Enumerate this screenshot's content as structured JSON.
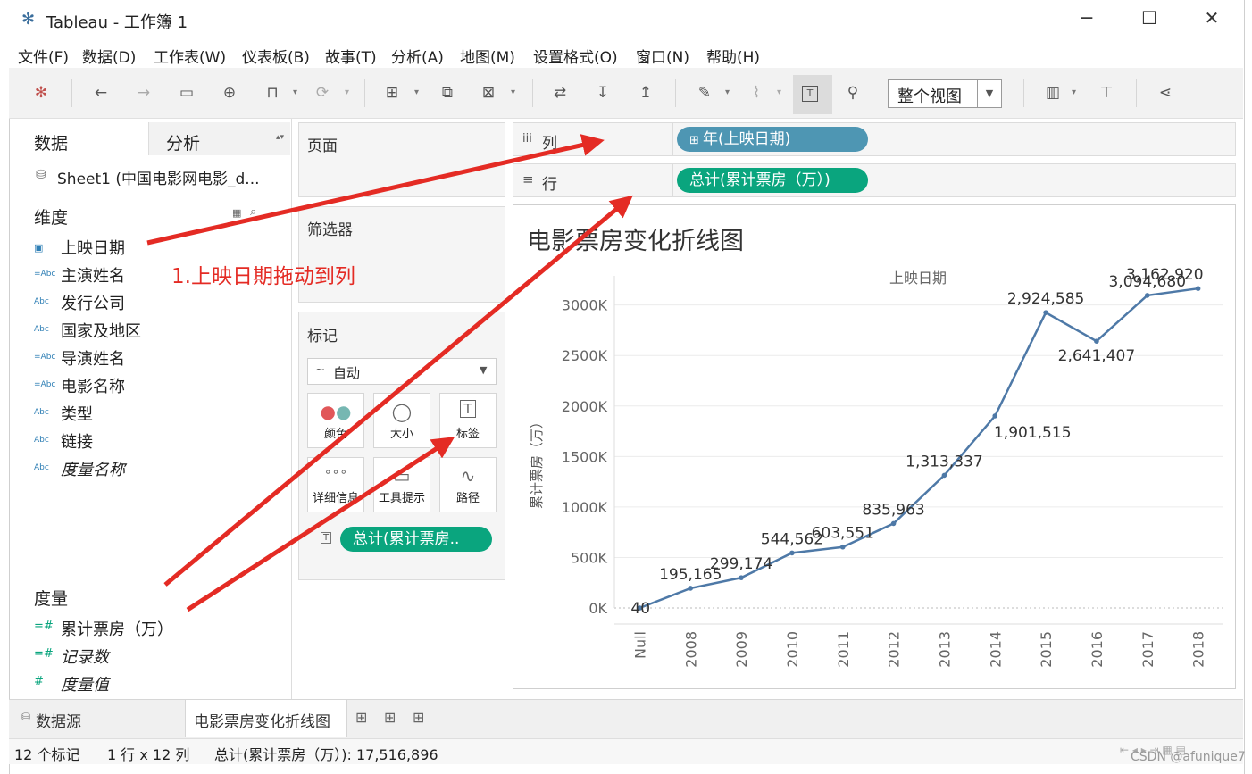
{
  "app": {
    "title": "Tableau - 工作簿 1",
    "window_controls": {
      "minimize": "─",
      "maximize": "☐",
      "close": "✕"
    }
  },
  "menu": [
    "文件(F)",
    "数据(D)",
    "工作表(W)",
    "仪表板(B)",
    "故事(T)",
    "分析(A)",
    "地图(M)",
    "设置格式(O)",
    "窗口(N)",
    "帮助(H)"
  ],
  "toolbar": {
    "view_select": "整个视图",
    "icons": [
      "tableau-logo-icon",
      "back-icon",
      "forward-icon",
      "save-icon",
      "add-datasource-icon",
      "pause-icon",
      "refresh-icon",
      "new-sheet-icon",
      "duplicate-icon",
      "clear-sheet-icon",
      "swap-icon",
      "sort-asc-icon",
      "sort-desc-icon",
      "highlight-icon",
      "group-icon",
      "labels-icon",
      "pin-icon",
      "show-me-icon",
      "presentation-icon",
      "share-icon"
    ]
  },
  "data_pane": {
    "tab_data": "数据",
    "tab_analysis": "分析",
    "datasource": "Sheet1 (中国电影网电影_d...",
    "dimensions_title": "维度",
    "dimensions": [
      {
        "label": "上映日期",
        "icon": "date-icon",
        "italic": false
      },
      {
        "label": "主演姓名",
        "icon": "abc-icon",
        "italic": false
      },
      {
        "label": "发行公司",
        "icon": "abc-icon",
        "italic": false
      },
      {
        "label": "国家及地区",
        "icon": "abc-icon",
        "italic": false
      },
      {
        "label": "导演姓名",
        "icon": "abc-icon",
        "italic": false
      },
      {
        "label": "电影名称",
        "icon": "abc-icon",
        "italic": false
      },
      {
        "label": "类型",
        "icon": "abc-icon",
        "italic": false
      },
      {
        "label": "链接",
        "icon": "abc-icon",
        "italic": false
      },
      {
        "label": "度量名称",
        "icon": "abc-icon",
        "italic": true
      }
    ],
    "measures_title": "度量",
    "measures": [
      {
        "label": "累计票房（万）",
        "italic": false
      },
      {
        "label": "记录数",
        "italic": true
      },
      {
        "label": "度量值",
        "italic": true
      }
    ]
  },
  "shelves": {
    "pages": "页面",
    "filters": "筛选器",
    "marks": "标记",
    "marks_type": "自动",
    "mark_buttons": [
      {
        "label": "颜色",
        "icon": "color-icon"
      },
      {
        "label": "大小",
        "icon": "size-icon"
      },
      {
        "label": "标签",
        "icon": "label-icon"
      },
      {
        "label": "详细信息",
        "icon": "detail-icon"
      },
      {
        "label": "工具提示",
        "icon": "tooltip-icon"
      },
      {
        "label": "路径",
        "icon": "path-icon"
      }
    ],
    "mark_pill": "总计(累计票房..",
    "columns_label": "列",
    "columns_pill": "年(上映日期)",
    "rows_label": "行",
    "rows_pill": "总计(累计票房（万）)"
  },
  "annotation": "1.上映日期拖动到列",
  "chart_data": {
    "type": "line",
    "title": "电影票房变化折线图",
    "header": "上映日期",
    "ylabel": "累计票房（万）",
    "categories": [
      "Null",
      "2008",
      "2009",
      "2010",
      "2011",
      "2012",
      "2013",
      "2014",
      "2015",
      "2016",
      "2017",
      "2018"
    ],
    "values": [
      40,
      195165,
      299174,
      544562,
      603551,
      835963,
      1313337,
      1901515,
      2924585,
      2641407,
      3094680,
      3162920
    ],
    "labels": [
      "40",
      "195,165",
      "299,174",
      "544,562",
      "603,551",
      "835,963",
      "1,313,337",
      "1,901,515",
      "2,924,585",
      "2,641,407",
      "3,094,680",
      "3,162,920"
    ],
    "yticks": [
      "0K",
      "500K",
      "1000K",
      "1500K",
      "2000K",
      "2500K",
      "3000K"
    ],
    "ytick_values": [
      0,
      500000,
      1000000,
      1500000,
      2000000,
      2500000,
      3000000
    ],
    "ylim": [
      0,
      3200000
    ],
    "line_color": "#4e79a7"
  },
  "bottom_tabs": {
    "datasource": "数据源",
    "sheet": "电影票房变化折线图"
  },
  "status": {
    "marks": "12 个标记",
    "dims": "1 行 x 12 列",
    "sum": "总计(累计票房（万）): 17,516,896"
  },
  "watermark": "CSDN @afunique7"
}
